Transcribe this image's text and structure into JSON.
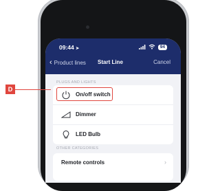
{
  "status_bar": {
    "time": "09:44",
    "battery": "94"
  },
  "nav": {
    "back_label": "Product lines",
    "title": "Start Line",
    "cancel_label": "Cancel"
  },
  "sections": {
    "plugs_label": "PLUGS AND LIGHTS",
    "plugs_items": [
      "On/off switch",
      "Dimmer",
      "LED Bulb"
    ],
    "other_label": "OTHER CATEGORIES",
    "other_items": [
      "Remote controls"
    ]
  },
  "callout": {
    "letter": "D"
  },
  "colors": {
    "header": "#1d2d6b",
    "accent_red": "#e0463e",
    "background": "#f1f2f6"
  },
  "icons": [
    "power-icon",
    "dimmer-icon",
    "bulb-icon",
    "chevron-right-icon",
    "wifi-icon",
    "signal-icon"
  ]
}
